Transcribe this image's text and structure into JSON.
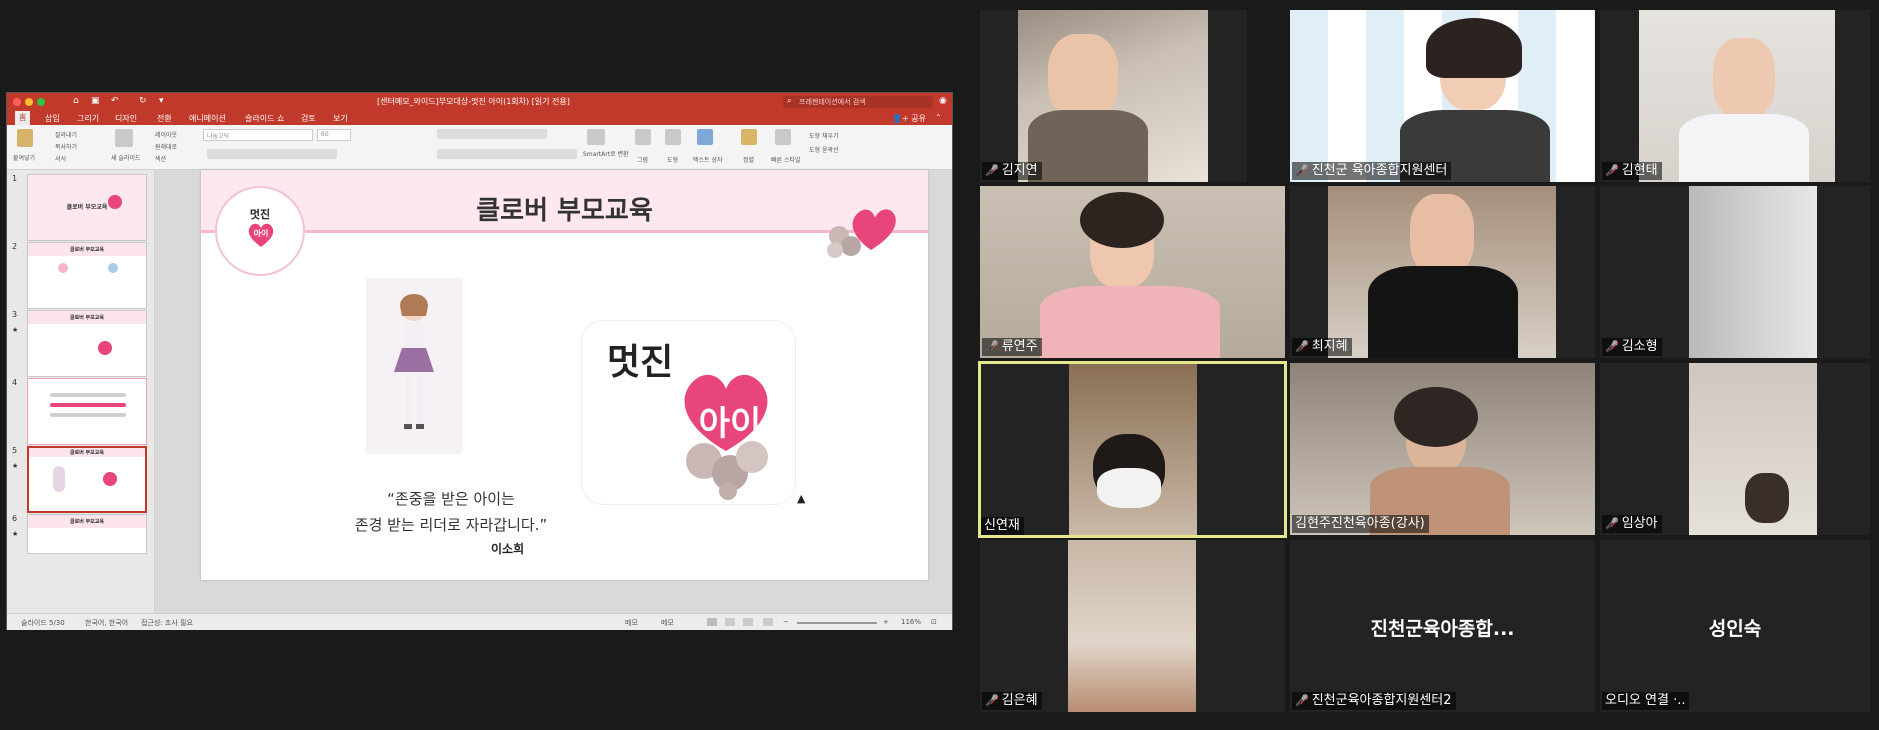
{
  "powerpoint": {
    "window_title": "[센터메모_와이드]부모대상-멋진 아이(1회차) [읽기 전용]",
    "search_placeholder": "프레젠테이션에서 검색",
    "share_label": "공유",
    "menu": [
      "홈",
      "삽입",
      "그리기",
      "디자인",
      "전환",
      "애니메이션",
      "슬라이드 쇼",
      "검토",
      "보기"
    ],
    "ribbon": {
      "paste": "붙여넣기",
      "cut": "잘라내기",
      "copy": "복사하기",
      "format": "서식",
      "new_slide": "새 슬라이드",
      "layout": "레이아웃",
      "reset": "원래대로",
      "section": "섹션",
      "font_name": "나눔고딕",
      "font_size": "60",
      "smartart": "SmartArt로 변환",
      "picture": "그림",
      "shapes": "도형",
      "textbox": "텍스트 상자",
      "arrange": "정렬",
      "quick_styles": "빠른 스타일",
      "shape_fill": "도형 채우기",
      "shape_outline": "도형 윤곽선"
    },
    "thumbnails": [
      {
        "num": "1",
        "title": "클로버 부모교육",
        "star": ""
      },
      {
        "num": "2",
        "title": "클로버 부모교육",
        "star": ""
      },
      {
        "num": "3",
        "title": "클로버 부모교육",
        "star": "★"
      },
      {
        "num": "4",
        "title": "",
        "star": ""
      },
      {
        "num": "5",
        "title": "클로버 부모교육",
        "star": "★"
      },
      {
        "num": "6",
        "title": "클로버 부모교육",
        "star": "★"
      }
    ],
    "slide": {
      "title": "클로버 부모교육",
      "logo_text": "멋진",
      "logo_heart_text": "아이",
      "box_word": "멋진",
      "box_heart_text": "아이",
      "quote_line1": "“존중을 받은 아이는",
      "quote_line2": "존경 받는 리더로 자라갑니다.”",
      "author": "이소희"
    },
    "status": {
      "slide_count": "슬라이드 5/30",
      "language": "한국어, 한국어",
      "accessibility": "접근성: 조사 필요",
      "notes": "메모",
      "comments": "메모",
      "zoom": "116%"
    }
  },
  "zoom": {
    "participants": [
      {
        "name": "김지연",
        "muted": true,
        "video": true
      },
      {
        "name": "진천군 육아종합지원센터",
        "muted": true,
        "video": true
      },
      {
        "name": "김현태",
        "muted": true,
        "video": true
      },
      {
        "name": "류연주",
        "muted": true,
        "video": true
      },
      {
        "name": "최지혜",
        "muted": true,
        "video": true
      },
      {
        "name": "김소형",
        "muted": true,
        "video": true
      },
      {
        "name": "신연재",
        "muted": false,
        "video": true,
        "active": true
      },
      {
        "name": "김현주진천육아종(강사)",
        "muted": false,
        "video": true
      },
      {
        "name": "임상아",
        "muted": true,
        "video": true
      },
      {
        "name": "김은혜",
        "muted": true,
        "video": true
      },
      {
        "name": "진천군육아종합지원센터2",
        "muted": true,
        "video": false,
        "display": "진천군육아종합..."
      },
      {
        "name": "오디오 연결 ·..",
        "muted": false,
        "video": false,
        "display": "성인숙"
      }
    ]
  },
  "colors": {
    "ppt_accent": "#c0392b",
    "active_speaker": "#e6e68a",
    "muted_icon": "#ff3b30",
    "heart_pink": "#e8457a"
  }
}
